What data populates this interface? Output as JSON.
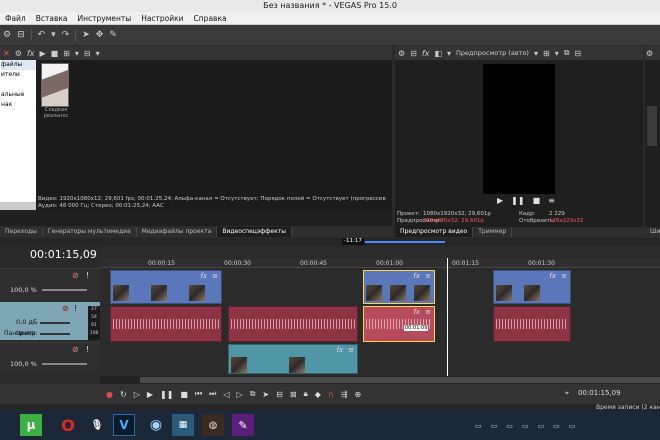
{
  "window": {
    "title": "Без названия * - VEGAS Pro 15.0"
  },
  "menu": [
    "Файл",
    "Вставка",
    "Инструменты",
    "Настройки",
    "Справка"
  ],
  "explorer": {
    "tree_items": [
      "файлы",
      "ители",
      "альные нак"
    ],
    "media_item_label": "Сладкая реальнос",
    "status_line1": "Видео: 1920x1080x12; 29,601 fps; 00:01:25,24; Альфа-канал = Отсутствует; Порядок полей = Отсутствует (прогрессив",
    "status_line2": "Аудио: 48 000 Гц; Стерео; 00:01:25,24; AAC",
    "tabs": [
      "Переходы",
      "Генераторы мультимедиа",
      "Медиафайлы проекта",
      "Видеоспецэффекты"
    ],
    "active_tab": "Видеоспецэффекты"
  },
  "preview": {
    "mode": "Предпросмотр (авто)",
    "project_label": "Проект:",
    "project_value": "1080x1920x32; 29,601p",
    "preview_label": "Предпросмотр:",
    "preview_value": "270x480x32; 29,601p",
    "frame_label": "Кадр:",
    "frame_value": "2 229",
    "display_label": "Отобразить:",
    "display_value": "126x223x32",
    "tabs": [
      "Предпросмотр видео",
      "Триммер"
    ],
    "active_tab": "Предпросмотр видео"
  },
  "right_edge_tab": "Ши",
  "timeline": {
    "timecode": "00:01:15,09",
    "cursor_badge": "-11:17",
    "ruler_ticks": [
      "00:00:15",
      "00:00:30",
      "00:00:45",
      "00:01:00",
      "00:01:15",
      "00:01:30"
    ],
    "tracks": [
      {
        "type": "video",
        "level": "100,0 %"
      },
      {
        "type": "audio",
        "volume": "0,0 дБ",
        "pan": "Центр",
        "pan_label": "Панорама:",
        "meter": [
          "27",
          "54",
          "81",
          "108"
        ]
      },
      {
        "type": "video",
        "level": "100,0 %"
      }
    ],
    "clip_tooltip": "00:01:09"
  },
  "transport": {
    "record_time_label": "Время записи (2 кан",
    "position": "00:01:15,09"
  },
  "colors": {
    "video_clip": "#5a78b9",
    "audio_clip": "#8d3344",
    "teal_clip": "#4f96a6",
    "preview_red": "#ff5a5a",
    "cursor": "#ffd54a"
  }
}
